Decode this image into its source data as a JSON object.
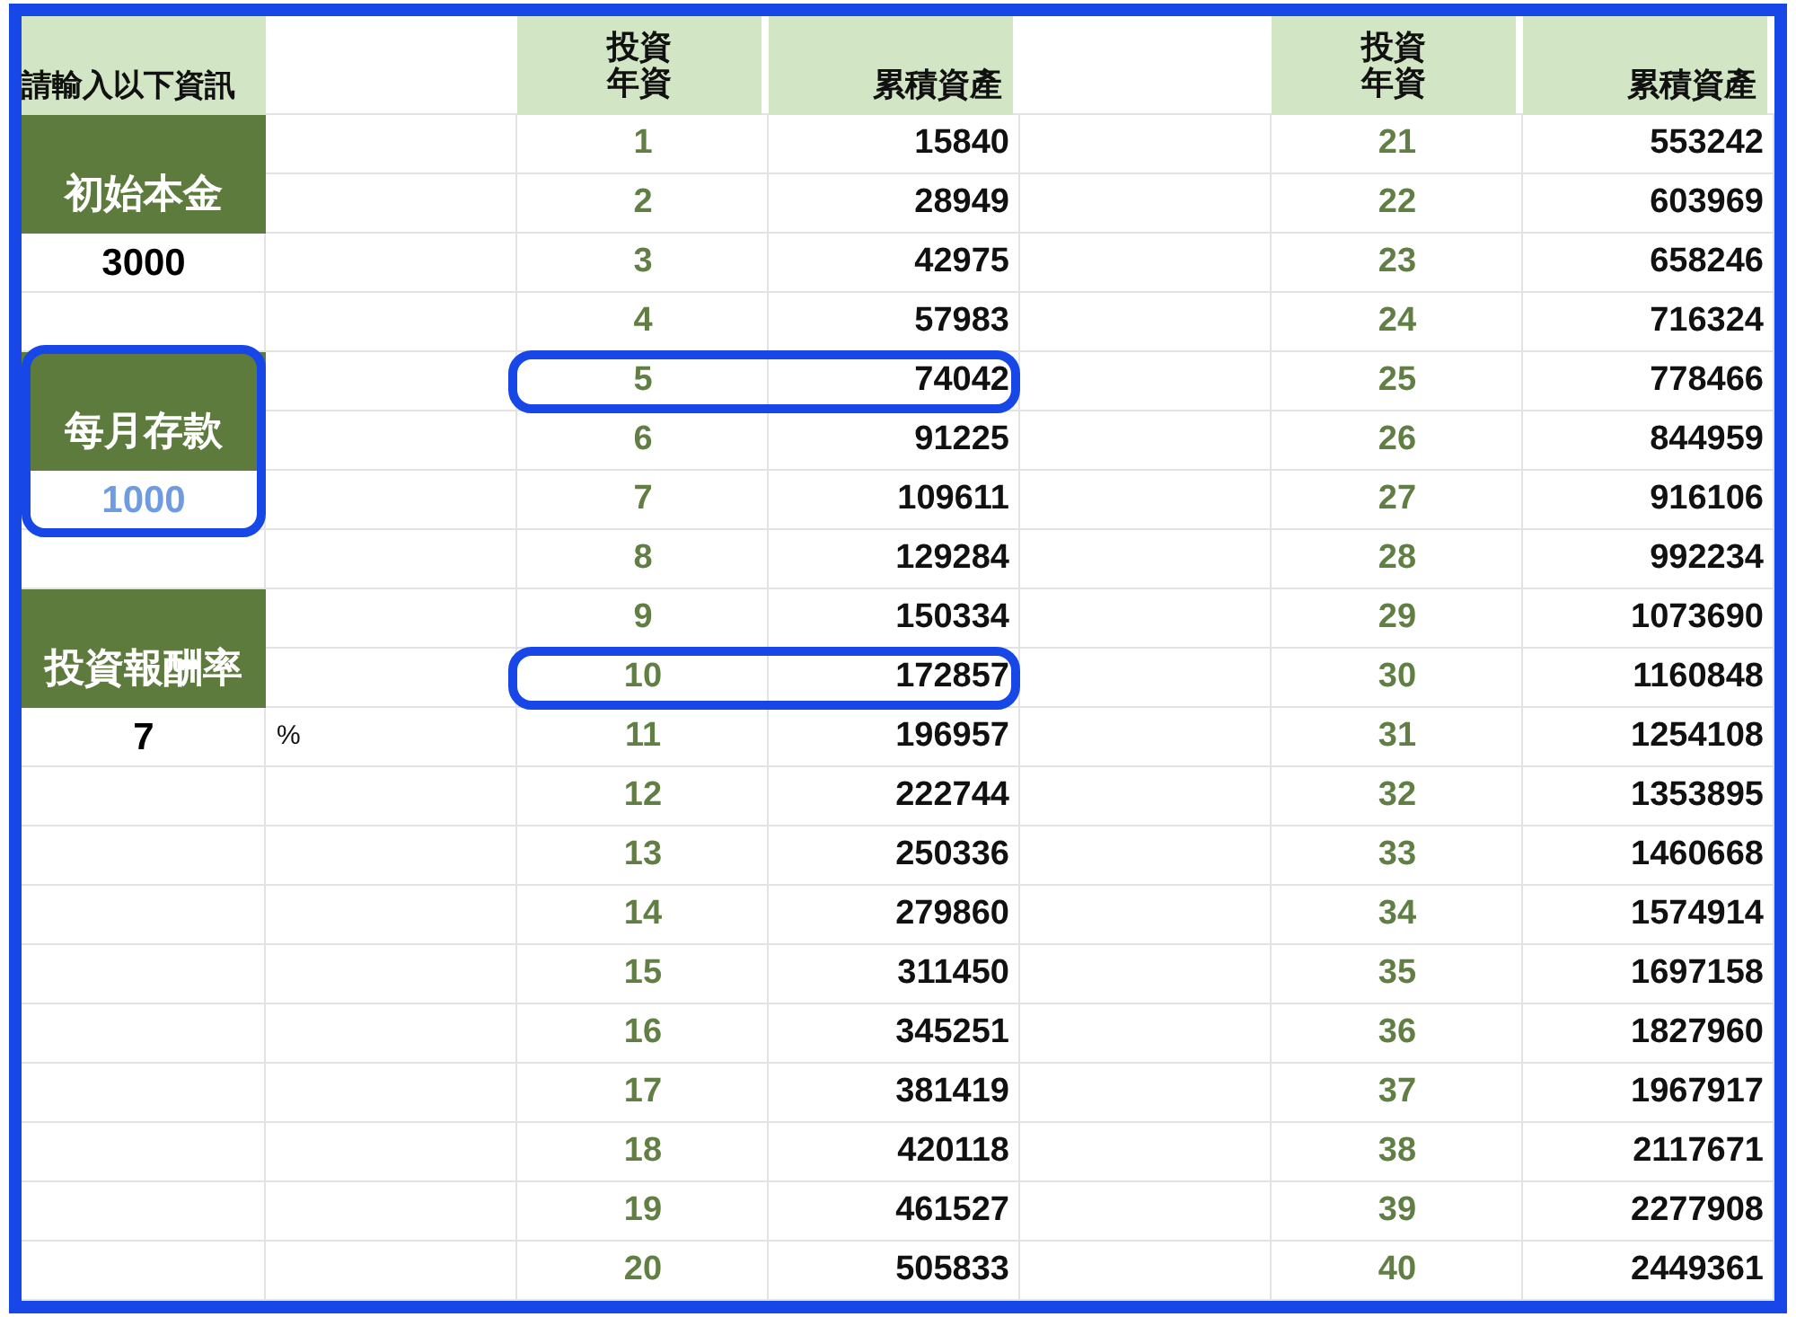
{
  "inputs_header": "請輸入以下資訊",
  "inputs": [
    {
      "label": "初始本金",
      "value": "3000",
      "color": "#000000",
      "circled": false
    },
    {
      "label": "每月存款",
      "value": "1000",
      "color": "#6f9be0",
      "circled": true
    },
    {
      "label": "投資報酬率",
      "value": "7",
      "unit": "%",
      "color": "#000000",
      "circled": false
    }
  ],
  "tables": [
    {
      "columns": [
        "投資年資",
        "累積資產"
      ],
      "rows": [
        {
          "year": "1",
          "total": "15840",
          "circled": false
        },
        {
          "year": "2",
          "total": "28949",
          "circled": false
        },
        {
          "year": "3",
          "total": "42975",
          "circled": false
        },
        {
          "year": "4",
          "total": "57983",
          "circled": false
        },
        {
          "year": "5",
          "total": "74042",
          "circled": true
        },
        {
          "year": "6",
          "total": "91225",
          "circled": false
        },
        {
          "year": "7",
          "total": "109611",
          "circled": false
        },
        {
          "year": "8",
          "total": "129284",
          "circled": false
        },
        {
          "year": "9",
          "total": "150334",
          "circled": false
        },
        {
          "year": "10",
          "total": "172857",
          "circled": true
        },
        {
          "year": "11",
          "total": "196957",
          "circled": false
        },
        {
          "year": "12",
          "total": "222744",
          "circled": false
        },
        {
          "year": "13",
          "total": "250336",
          "circled": false
        },
        {
          "year": "14",
          "total": "279860",
          "circled": false
        },
        {
          "year": "15",
          "total": "311450",
          "circled": false
        },
        {
          "year": "16",
          "total": "345251",
          "circled": false
        },
        {
          "year": "17",
          "total": "381419",
          "circled": false
        },
        {
          "year": "18",
          "total": "420118",
          "circled": false
        },
        {
          "year": "19",
          "total": "461527",
          "circled": false
        },
        {
          "year": "20",
          "total": "505833",
          "circled": false
        }
      ]
    },
    {
      "columns": [
        "投資年資",
        "累積資產"
      ],
      "rows": [
        {
          "year": "21",
          "total": "553242",
          "circled": false
        },
        {
          "year": "22",
          "total": "603969",
          "circled": false
        },
        {
          "year": "23",
          "total": "658246",
          "circled": false
        },
        {
          "year": "24",
          "total": "716324",
          "circled": false
        },
        {
          "year": "25",
          "total": "778466",
          "circled": false
        },
        {
          "year": "26",
          "total": "844959",
          "circled": false
        },
        {
          "year": "27",
          "total": "916106",
          "circled": false
        },
        {
          "year": "28",
          "total": "992234",
          "circled": false
        },
        {
          "year": "29",
          "total": "1073690",
          "circled": false
        },
        {
          "year": "30",
          "total": "1160848",
          "circled": false
        },
        {
          "year": "31",
          "total": "1254108",
          "circled": false
        },
        {
          "year": "32",
          "total": "1353895",
          "circled": false
        },
        {
          "year": "33",
          "total": "1460668",
          "circled": false
        },
        {
          "year": "34",
          "total": "1574914",
          "circled": false
        },
        {
          "year": "35",
          "total": "1697158",
          "circled": false
        },
        {
          "year": "36",
          "total": "1827960",
          "circled": false
        },
        {
          "year": "37",
          "total": "1967917",
          "circled": false
        },
        {
          "year": "38",
          "total": "2117671",
          "circled": false
        },
        {
          "year": "39",
          "total": "2277908",
          "circled": false
        },
        {
          "year": "40",
          "total": "2449361",
          "circled": false
        }
      ]
    }
  ]
}
